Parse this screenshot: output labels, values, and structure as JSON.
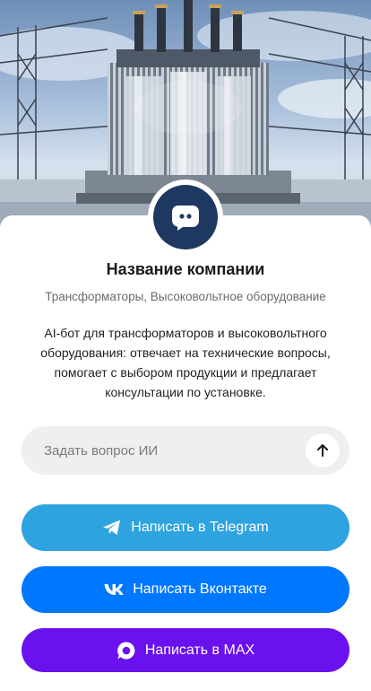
{
  "company": {
    "name": "Название компании",
    "tags": "Трансформаторы, Высоковольтное оборудование",
    "description": "AI-бот для трансформаторов и высоковольтного оборудования: отвечает на технические вопросы, помогает с выбором продукции и предлагает консультации по установке."
  },
  "ask": {
    "placeholder": "Задать вопрос ИИ"
  },
  "buttons": {
    "telegram": "Написать в Telegram",
    "vk": "Написать Вконтакте",
    "max": "Написать в MAX"
  },
  "icons": {
    "avatar": "chat-bot-icon",
    "send": "arrow-up-icon",
    "telegram": "telegram-icon",
    "vk": "vk-icon",
    "max": "max-icon"
  },
  "colors": {
    "avatar_bg": "#1f3861",
    "telegram": "#2ea3e0",
    "vk": "#0077ff",
    "max": "#6a11ee"
  }
}
